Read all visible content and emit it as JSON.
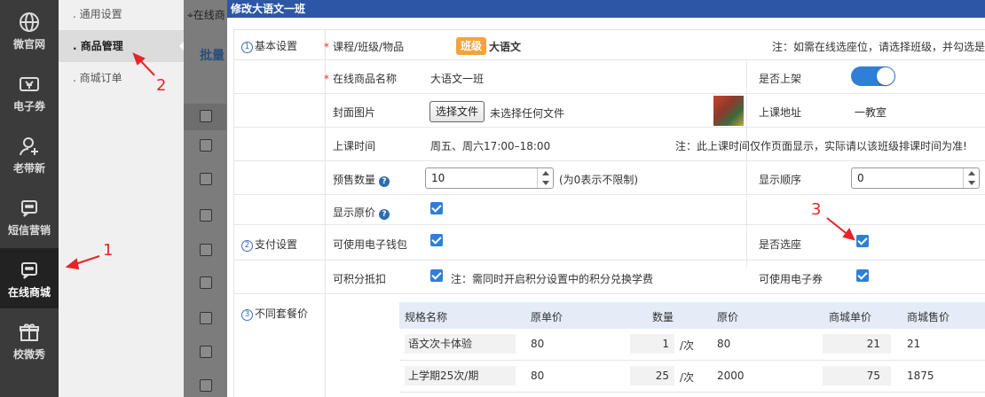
{
  "sidebar": {
    "items": [
      {
        "label": "微官网",
        "icon": "globe-icon"
      },
      {
        "label": "电子券",
        "icon": "coupon-icon"
      },
      {
        "label": "老带新",
        "icon": "user-add-icon"
      },
      {
        "label": "短信营销",
        "icon": "sms-icon"
      },
      {
        "label": "在线商城",
        "icon": "shop-chat-icon",
        "active": true
      },
      {
        "label": "校微秀",
        "icon": "gift-icon"
      }
    ]
  },
  "submenu": {
    "items": [
      {
        "label": ". 通用设置"
      },
      {
        "label": ". 商品管理",
        "active": true
      },
      {
        "label": ". 商城订单"
      }
    ]
  },
  "background_page": {
    "breadcrumb": "在线商",
    "batch_label": "批量"
  },
  "dialog": {
    "title": "修改大语文一班",
    "sections": {
      "basic": {
        "num": "1",
        "label": "基本设置"
      },
      "payment": {
        "num": "2",
        "label": "支付设置"
      },
      "packages": {
        "num": "3",
        "label": "不同套餐价"
      }
    },
    "fields": {
      "course_label": "课程/班级/物品",
      "course_badge": "班级",
      "course_name": "大语文",
      "course_note": "注：如需在线选座位，请选择班级，并勾选是",
      "product_name_label": "在线商品名称",
      "product_name_value": "大语文一班",
      "on_shelf_label": "是否上架",
      "on_shelf": true,
      "cover_label": "封面图片",
      "file_button": "选择文件",
      "file_status": "未选择任何文件",
      "location_label": "上课地址",
      "location_value": "一教室",
      "time_label": "上课时间",
      "time_value": "周五、周六17:00–18:00",
      "time_note": "注：此上课时间仅作页面显示，实际请以该班级排课时间为准!",
      "presale_label": "预售数量",
      "presale_value": "10",
      "presale_hint": "(为0表示不限制)",
      "order_label": "显示顺序",
      "order_value": "0",
      "show_price_label": "显示原价",
      "show_price": true,
      "wallet_label": "可使用电子钱包",
      "wallet": true,
      "seat_label": "是否选座",
      "seat": true,
      "points_label": "可积分抵扣",
      "points": true,
      "points_note": "注：需同时开启积分设置中的积分兑换学费",
      "coupon_label": "可使用电子券",
      "coupon": true
    },
    "package_table": {
      "headers": [
        "规格名称",
        "原单价",
        "数量",
        "原价",
        "商城单价",
        "商城售价"
      ],
      "rows": [
        {
          "name": "语文次卡体验",
          "unit_price": "80",
          "qty": "1",
          "unit": "/次",
          "orig": "80",
          "mall_unit": "21",
          "mall_total": "21"
        },
        {
          "name": "上学期25次/期",
          "unit_price": "80",
          "qty": "25",
          "unit": "/次",
          "orig": "2000",
          "mall_unit": "75",
          "mall_total": "1875"
        }
      ]
    }
  },
  "annotations": {
    "n1": "1",
    "n2": "2",
    "n3": "3",
    "color": "#e8242a"
  }
}
